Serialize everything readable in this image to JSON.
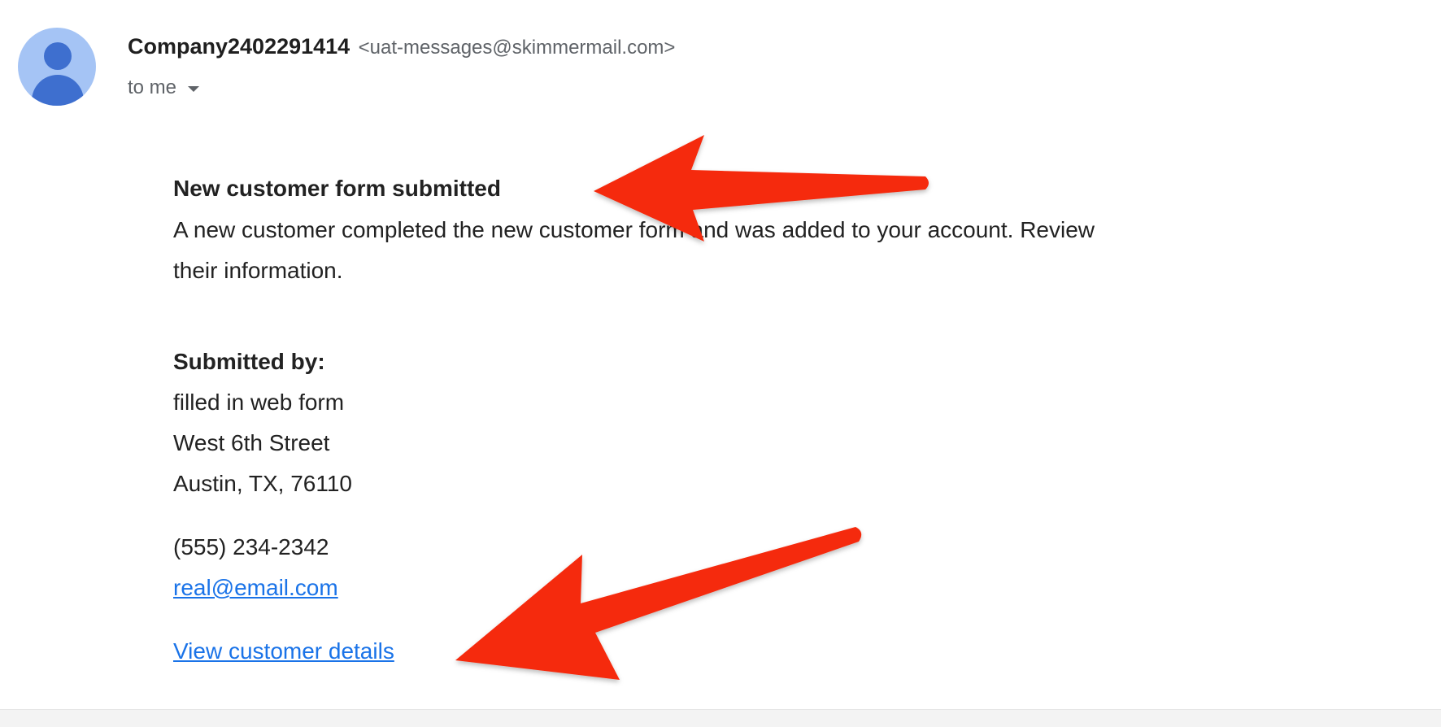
{
  "sender": {
    "name": "Company2402291414",
    "email": "<uat-messages@skimmermail.com>",
    "recipient_label": "to me"
  },
  "icons": {
    "avatar": "default-person-avatar",
    "recipient_caret": "caret-down-icon"
  },
  "message": {
    "heading": "New customer form submitted",
    "intro_line1": "A new customer completed the new customer form and was added to your account. Review",
    "intro_line2": "their information.",
    "submitted_by_label": "Submitted by:",
    "address": [
      "filled in web form",
      "West 6th Street",
      "Austin, TX, 76110"
    ],
    "phone": "(555) 234-2342",
    "email_link": "real@email.com",
    "details_link": "View customer details"
  },
  "colors": {
    "link": "#1a73e8",
    "annotation_arrow": "#f52a0c",
    "avatar_bg": "#a5c4f5",
    "avatar_fg": "#3e6fcf"
  }
}
